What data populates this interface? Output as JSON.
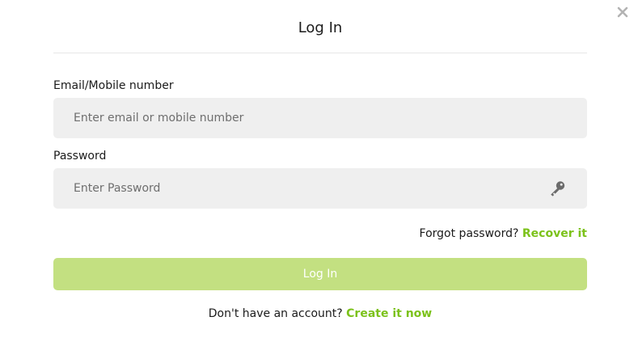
{
  "title": "Log In",
  "close_icon": "close-icon",
  "email": {
    "label": "Email/Mobile number",
    "placeholder": "Enter email or mobile number",
    "value": ""
  },
  "password": {
    "label": "Password",
    "placeholder": "Enter Password",
    "value": "",
    "icon": "key-icon"
  },
  "forgot": {
    "text": "Forgot password?",
    "link": "Recover it"
  },
  "login_button": {
    "label": "Log In",
    "color": "#c3e081"
  },
  "signup": {
    "text": "Don't have an account?",
    "link": "Create it now"
  },
  "colors": {
    "accent": "#7cc21b",
    "field_bg": "#efefef"
  }
}
